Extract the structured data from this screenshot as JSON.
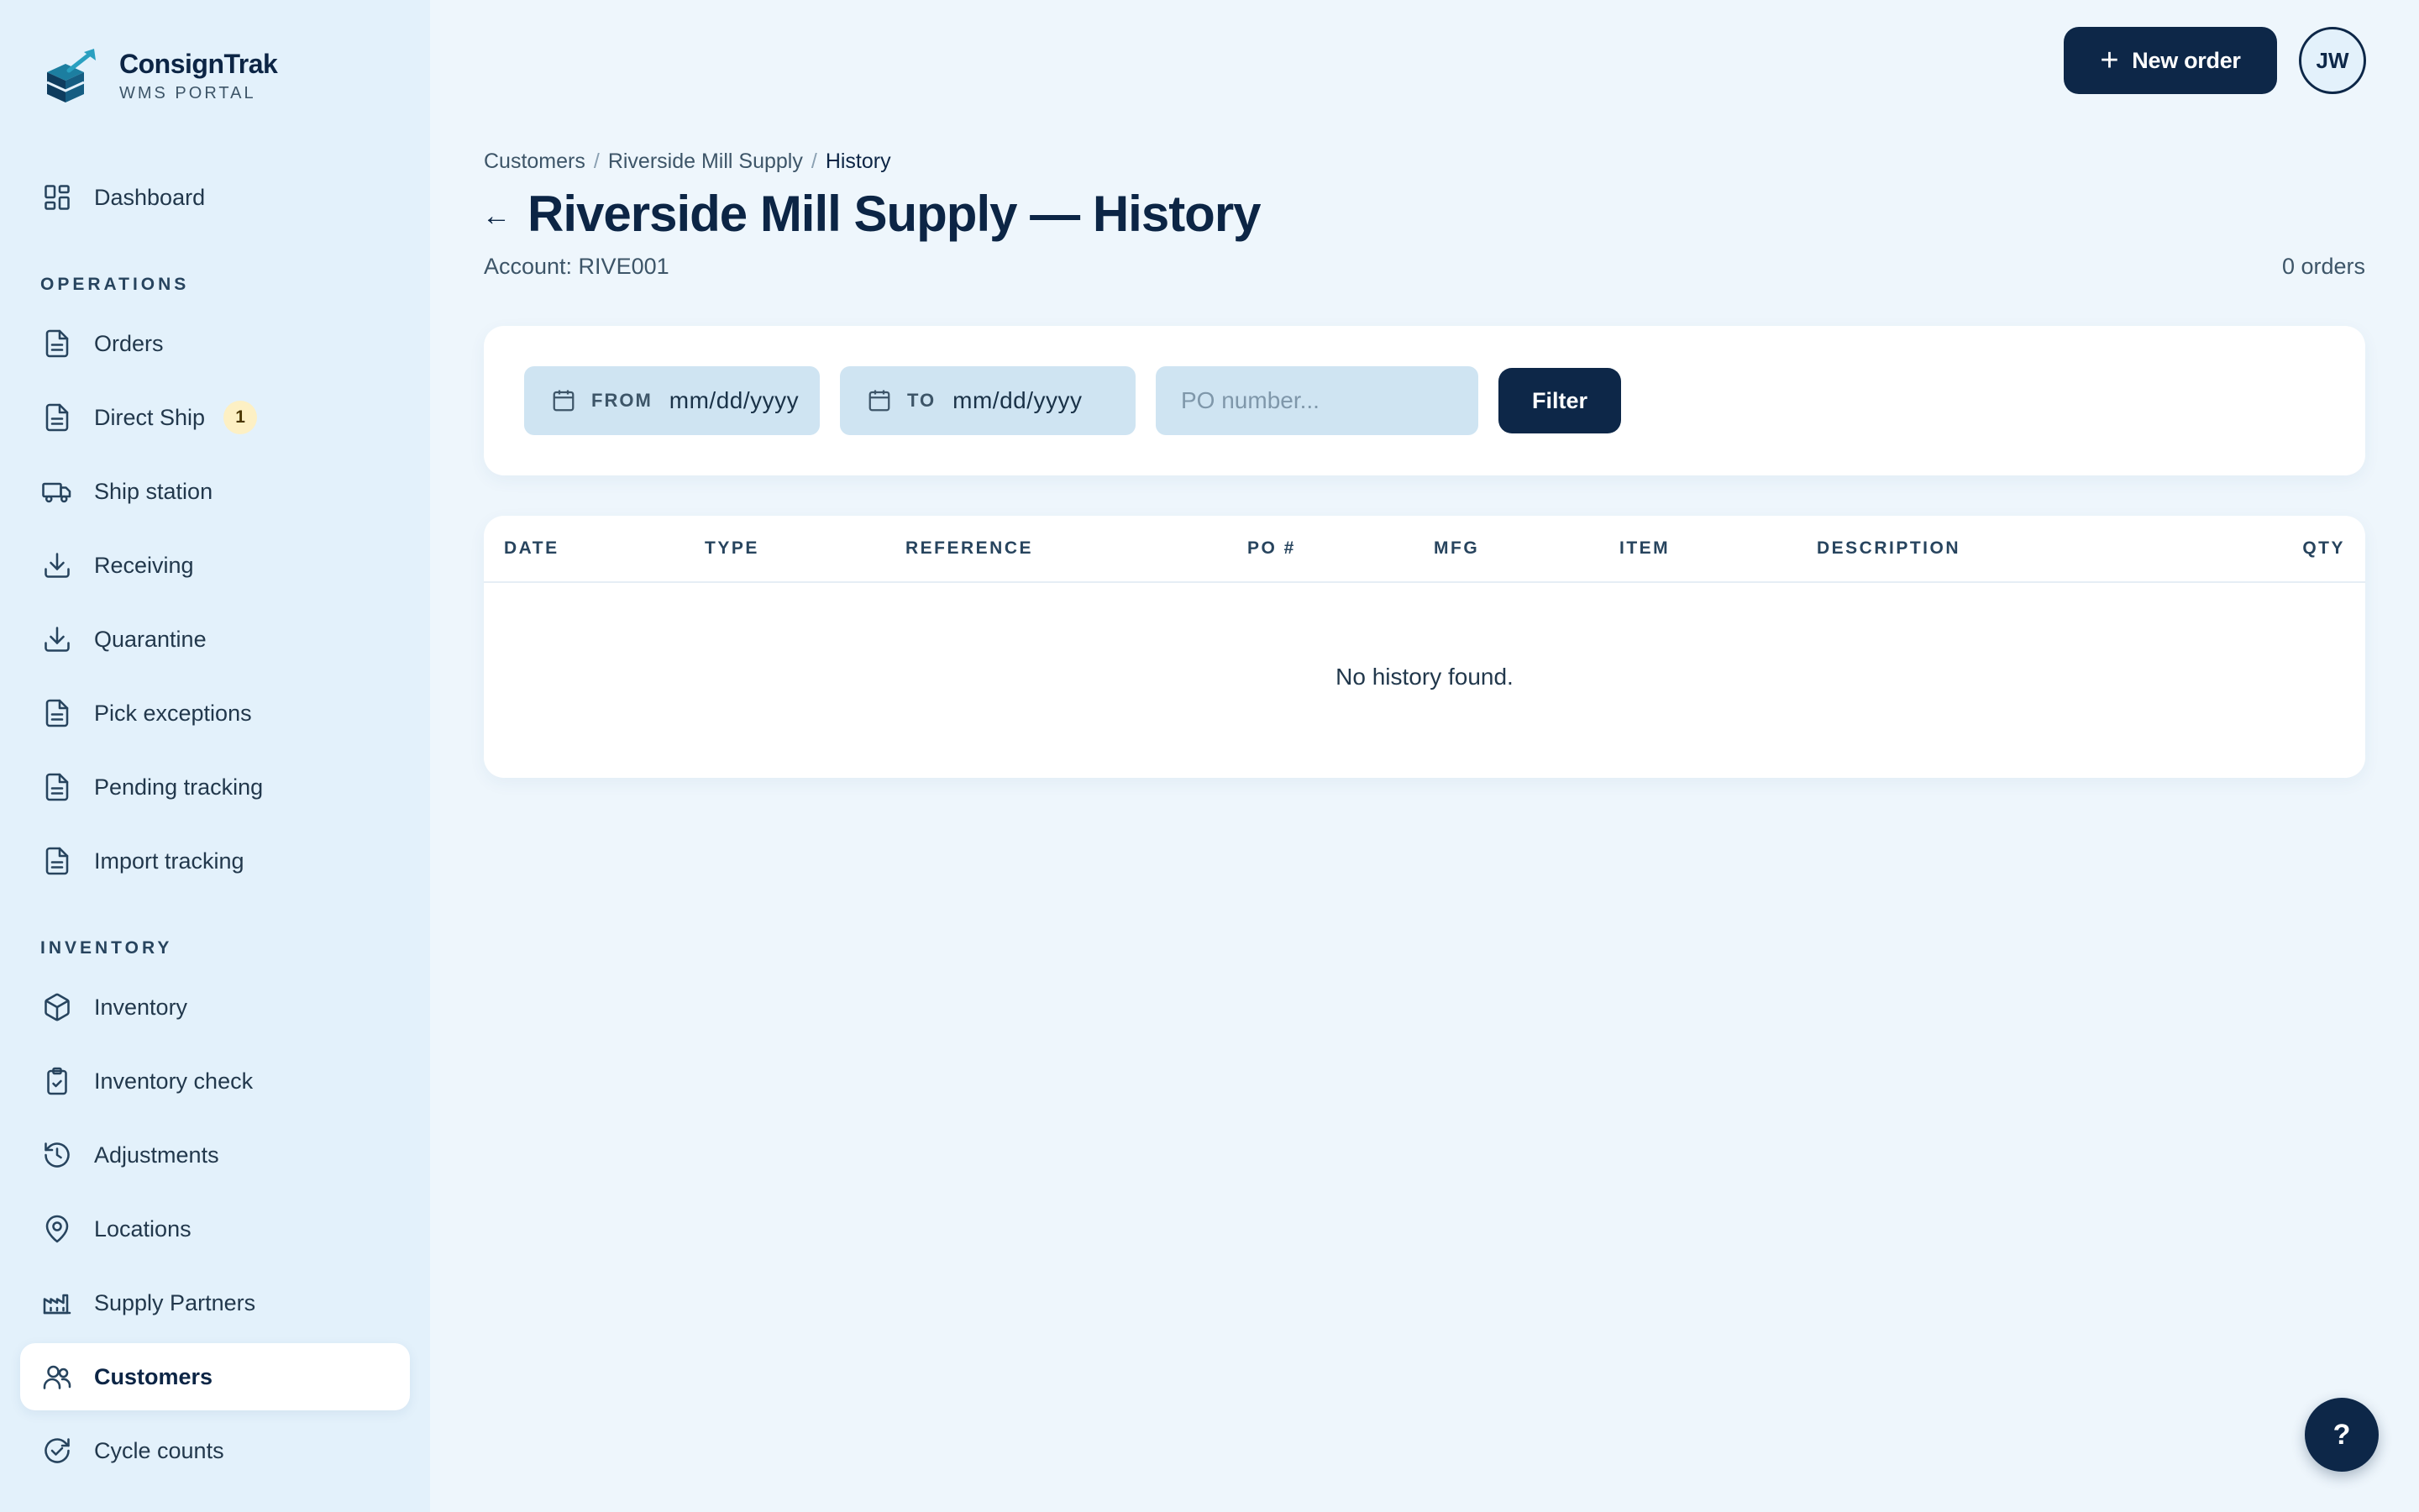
{
  "brand": {
    "name": "ConsignTrak",
    "subtitle": "WMS PORTAL"
  },
  "sidebar": {
    "dashboard": "Dashboard",
    "operations_label": "OPERATIONS",
    "operations": [
      {
        "label": "Orders",
        "icon": "document-icon"
      },
      {
        "label": "Direct Ship",
        "icon": "document-icon",
        "badge": "1"
      },
      {
        "label": "Ship station",
        "icon": "truck-icon"
      },
      {
        "label": "Receiving",
        "icon": "download-icon"
      },
      {
        "label": "Quarantine",
        "icon": "download-icon"
      },
      {
        "label": "Pick exceptions",
        "icon": "document-icon"
      },
      {
        "label": "Pending tracking",
        "icon": "document-icon"
      },
      {
        "label": "Import tracking",
        "icon": "document-icon"
      }
    ],
    "inventory_label": "INVENTORY",
    "inventory": [
      {
        "label": "Inventory",
        "icon": "box-icon"
      },
      {
        "label": "Inventory check",
        "icon": "clipboard-check-icon"
      },
      {
        "label": "Adjustments",
        "icon": "history-icon"
      },
      {
        "label": "Locations",
        "icon": "map-pin-icon"
      },
      {
        "label": "Supply Partners",
        "icon": "factory-icon"
      },
      {
        "label": "Customers",
        "icon": "users-icon",
        "active": true
      },
      {
        "label": "Cycle counts",
        "icon": "refresh-check-icon"
      }
    ]
  },
  "topbar": {
    "new_order_label": "New order",
    "avatar_initials": "JW"
  },
  "breadcrumb": [
    "Customers",
    "Riverside Mill Supply",
    "History"
  ],
  "header": {
    "title": "Riverside Mill Supply — History",
    "account": "Account: RIVE001",
    "order_count": "0 orders"
  },
  "filters": {
    "from_label": "FROM",
    "from_value": "mm/dd/yyyy",
    "to_label": "TO",
    "to_value": "mm/dd/yyyy",
    "po_placeholder": "PO number...",
    "filter_label": "Filter"
  },
  "table": {
    "columns": [
      "DATE",
      "TYPE",
      "REFERENCE",
      "PO #",
      "MFG",
      "ITEM",
      "DESCRIPTION",
      "QTY"
    ],
    "empty_message": "No history found."
  },
  "help_label": "?",
  "colors": {
    "navy": "#0d2748",
    "sidebar_bg": "#e3f1fb",
    "page_bg": "#eef6fc",
    "input_bg": "#cfe4f2",
    "badge_bg": "#fdf0c4"
  }
}
